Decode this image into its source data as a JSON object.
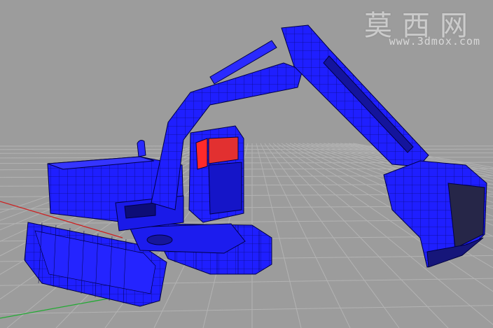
{
  "viewport": {
    "background": "#9c9c9c",
    "grid_color": "#b3b3b3",
    "x_axis_color": "#cc2222",
    "y_axis_color": "#22aa33"
  },
  "model": {
    "name_icon": "excavator-wireframe-icon",
    "wire_color": "#1a1aff",
    "edge_color": "#000044",
    "highlight_color": "#ff2a2a"
  },
  "watermark": {
    "title": "莫西网",
    "url": "www.3dmox.com"
  }
}
